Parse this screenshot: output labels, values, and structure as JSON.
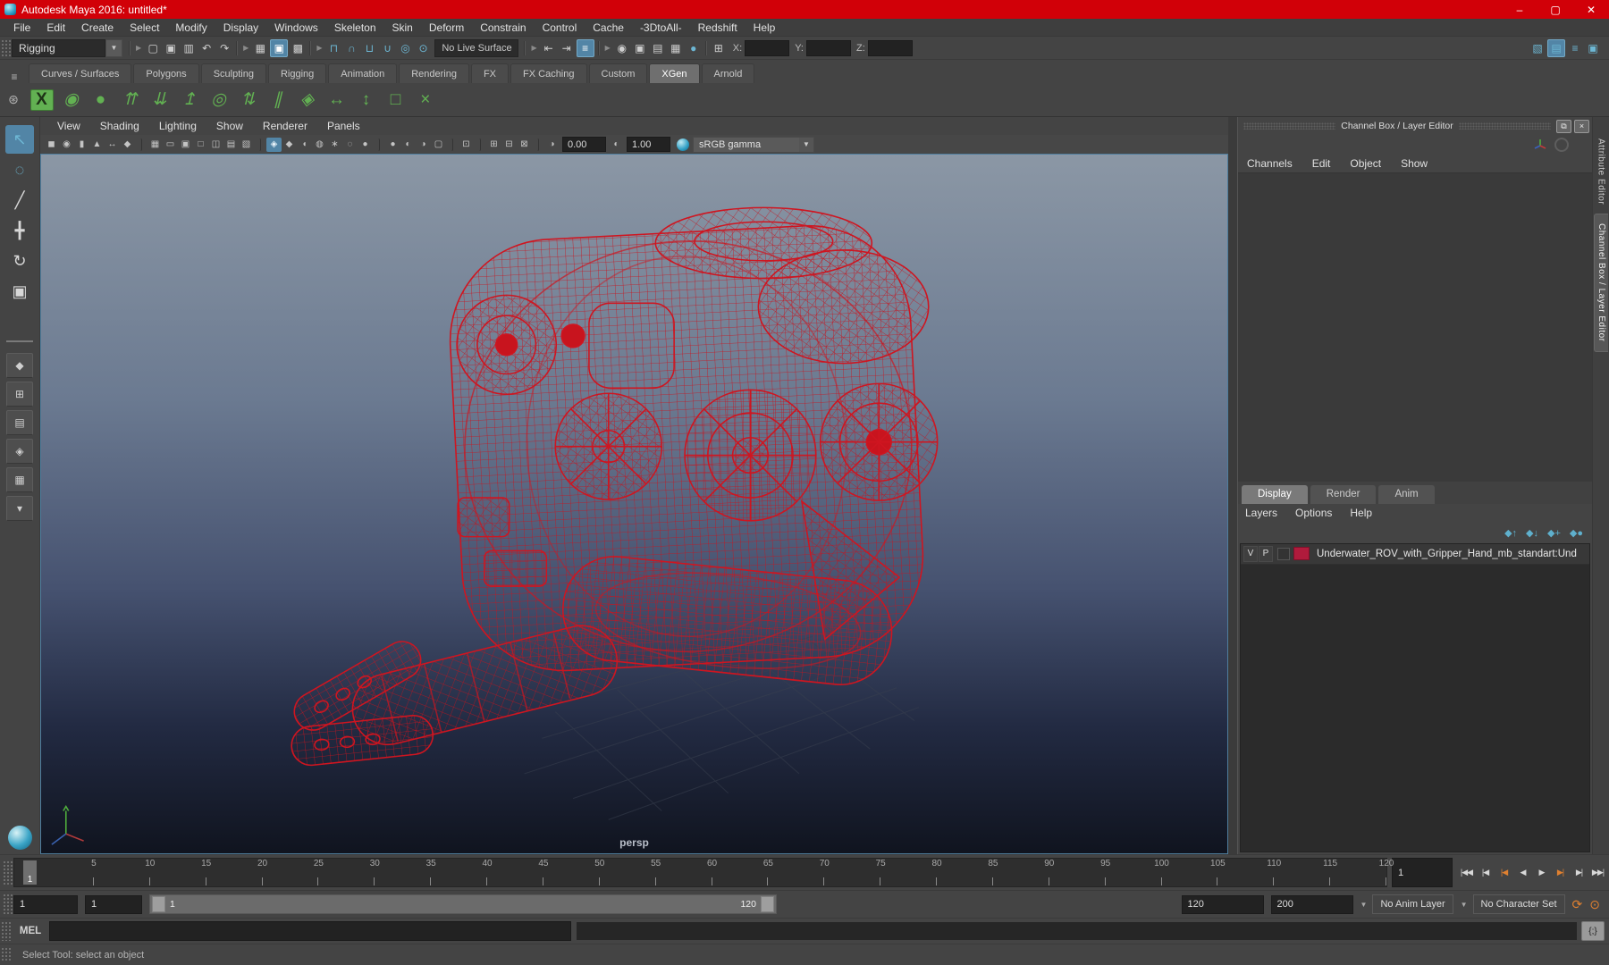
{
  "window": {
    "title": "Autodesk Maya 2016: untitled*",
    "controls": [
      {
        "name": "minimize-button",
        "g": "–"
      },
      {
        "name": "maximize-button",
        "g": "▢"
      },
      {
        "name": "close-button",
        "g": "✕"
      }
    ]
  },
  "menubar": {
    "items": [
      "File",
      "Edit",
      "Create",
      "Select",
      "Modify",
      "Display",
      "Windows",
      "Skeleton",
      "Skin",
      "Deform",
      "Constrain",
      "Control",
      "Cache",
      "-3DtoAll-",
      "Redshift",
      "Help"
    ]
  },
  "statusline": {
    "menuset": "Rigging",
    "file_icons": [
      {
        "g": "▢"
      },
      {
        "g": "▣"
      },
      {
        "g": "▥"
      },
      {
        "g": "↶"
      },
      {
        "g": "↷"
      }
    ],
    "selection_icons": [
      {
        "g": "▦"
      },
      {
        "g": "▣",
        "cls": "on"
      },
      {
        "g": "▩"
      }
    ],
    "snap_icons": [
      {
        "g": "⊓"
      },
      {
        "g": "∩"
      },
      {
        "g": "⊔"
      },
      {
        "g": "∪"
      },
      {
        "g": "◎"
      },
      {
        "g": "⊙"
      }
    ],
    "live_surface": "No Live Surface",
    "history_icons": [
      {
        "g": "⇤"
      },
      {
        "g": "⇥"
      },
      {
        "g": "≡",
        "cls": "on"
      }
    ],
    "render_icons": [
      {
        "g": "◉"
      },
      {
        "g": "▣"
      },
      {
        "g": "▤"
      },
      {
        "g": "▦"
      },
      {
        "g": "●",
        "cls": "teal"
      }
    ],
    "symmetry_icon": "⊞",
    "coords": [
      {
        "label": "X:"
      },
      {
        "label": "Y:"
      },
      {
        "label": "Z:"
      }
    ],
    "sidebar_toggles": [
      {
        "g": "▧"
      },
      {
        "g": "▤",
        "cls": "on"
      },
      {
        "g": "≡"
      },
      {
        "g": "▣",
        "cls": "teal"
      }
    ]
  },
  "shelf": {
    "menu_icon": "≡",
    "gear_icon": "⊛",
    "tabs": [
      {
        "label": "Curves / Surfaces"
      },
      {
        "label": "Polygons"
      },
      {
        "label": "Sculpting"
      },
      {
        "label": "Rigging"
      },
      {
        "label": "Animation"
      },
      {
        "label": "Rendering"
      },
      {
        "label": "FX"
      },
      {
        "label": "FX Caching"
      },
      {
        "label": "Custom"
      },
      {
        "label": "XGen",
        "cls": "active"
      },
      {
        "label": "Arnold"
      }
    ],
    "icons": [
      {
        "g": "X",
        "cls": "boxed"
      },
      {
        "g": "◉"
      },
      {
        "g": "●"
      },
      {
        "g": "⇈"
      },
      {
        "g": "⇊"
      },
      {
        "g": "↥"
      },
      {
        "g": "◎"
      },
      {
        "g": "⇅"
      },
      {
        "g": "∥"
      },
      {
        "g": "◈"
      },
      {
        "g": "↔"
      },
      {
        "g": "↕"
      },
      {
        "g": "□"
      },
      {
        "g": "×"
      }
    ]
  },
  "toolbox": {
    "tools": [
      {
        "g": "↖",
        "cls": "active"
      },
      {
        "g": "◌"
      },
      {
        "g": "╱"
      },
      {
        "g": "╋"
      },
      {
        "g": "↻"
      },
      {
        "g": "▣"
      }
    ],
    "layouts": [
      {
        "g": "◆"
      },
      {
        "g": "⊞"
      },
      {
        "g": "▤"
      },
      {
        "g": "◈"
      },
      {
        "g": "▦"
      },
      {
        "g": "▾"
      }
    ]
  },
  "viewport": {
    "menus": [
      "View",
      "Shading",
      "Lighting",
      "Show",
      "Renderer",
      "Panels"
    ],
    "toolbar_icons": [
      {
        "g": "◼"
      },
      {
        "g": "◉"
      },
      {
        "g": "▮"
      },
      {
        "g": "▲"
      },
      {
        "g": "↔"
      },
      {
        "g": "◆"
      },
      {
        "g": "",
        "cls": "sep"
      },
      {
        "g": "▦"
      },
      {
        "g": "▭"
      },
      {
        "g": "▣"
      },
      {
        "g": "□"
      },
      {
        "g": "◫"
      },
      {
        "g": "▤"
      },
      {
        "g": "▧"
      },
      {
        "g": "",
        "cls": "sep"
      },
      {
        "g": "◈",
        "cls": "on"
      },
      {
        "g": "◆"
      },
      {
        "g": "◖"
      },
      {
        "g": "◍"
      },
      {
        "g": "∗"
      },
      {
        "g": "◌"
      },
      {
        "g": "●"
      },
      {
        "g": "",
        "cls": "sep"
      },
      {
        "g": "●"
      },
      {
        "g": "◐"
      },
      {
        "g": "◑"
      },
      {
        "g": "▢"
      },
      {
        "g": "",
        "cls": "sep"
      },
      {
        "g": "⊡"
      },
      {
        "g": "",
        "cls": "sep"
      },
      {
        "g": "⊞"
      },
      {
        "g": "⊟"
      },
      {
        "g": "⊠"
      },
      {
        "g": "",
        "cls": "sep"
      }
    ],
    "exposure": "0.00",
    "gamma": "1.00",
    "color_mode": "sRGB gamma",
    "camera_label": "persp"
  },
  "channelbox": {
    "title": "Channel Box / Layer Editor",
    "popout_icon": "⧉",
    "close_icon": "×",
    "menus": [
      "Channels",
      "Edit",
      "Object",
      "Show"
    ]
  },
  "layer_editor": {
    "tabs": [
      {
        "label": "Display",
        "cls": "active"
      },
      {
        "label": "Render"
      },
      {
        "label": "Anim"
      }
    ],
    "menus": [
      "Layers",
      "Options",
      "Help"
    ],
    "tools": [
      {
        "g": "◆↑"
      },
      {
        "g": "◆↓"
      },
      {
        "g": "◆+"
      },
      {
        "g": "◆●"
      }
    ],
    "layers": [
      {
        "visibility": "V",
        "playback": "P",
        "name": "Underwater_ROV_with_Gripper_Hand_mb_standart:Und"
      }
    ]
  },
  "sidebar_tabs": [
    {
      "label": "Attribute Editor"
    },
    {
      "label": "Channel Box / Layer Editor",
      "cls": "active"
    }
  ],
  "timeline": {
    "current_frame": "1",
    "ticks": [
      {
        "label": "5"
      },
      {
        "label": "10"
      },
      {
        "label": "15"
      },
      {
        "label": "20"
      },
      {
        "label": "25"
      },
      {
        "label": "30"
      },
      {
        "label": "35"
      },
      {
        "label": "40"
      },
      {
        "label": "45"
      },
      {
        "label": "50"
      },
      {
        "label": "55"
      },
      {
        "label": "60"
      },
      {
        "label": "65"
      },
      {
        "label": "70"
      },
      {
        "label": "75"
      },
      {
        "label": "80"
      },
      {
        "label": "85"
      },
      {
        "label": "90"
      },
      {
        "label": "95"
      },
      {
        "label": "100"
      },
      {
        "label": "105"
      },
      {
        "label": "110"
      },
      {
        "label": "115"
      },
      {
        "label": "120"
      }
    ],
    "frame_field": "1",
    "playback": [
      {
        "g": "|◀◀"
      },
      {
        "g": "|◀"
      },
      {
        "g": "|◀",
        "cls": "accent"
      },
      {
        "g": "◀"
      },
      {
        "g": "▶"
      },
      {
        "g": "▶|",
        "cls": "accent"
      },
      {
        "g": "▶|"
      },
      {
        "g": "▶▶|"
      }
    ]
  },
  "range_slider": {
    "anim_start": "1",
    "play_start": "1",
    "bar_start": "1",
    "bar_end": "120",
    "play_end": "120",
    "anim_end": "200",
    "anim_layer": "No Anim Layer",
    "character_set": "No Character Set",
    "autokey_icon": "⟳",
    "charkey_icon": "⊙"
  },
  "command_line": {
    "label": "MEL",
    "script_editor_icon": "{;}"
  },
  "help_line": {
    "text": "Select Tool: select an object"
  },
  "colors": {
    "titlebar_red": "#d10008",
    "selection_blue": "#5285a6",
    "accent_teal": "#5fb0cd",
    "shelf_green": "#62b152",
    "wireframe_red": "#c8141e",
    "layer_swatch": "#b01b3c",
    "viewport_top": "#8b97a5",
    "viewport_bottom": "#10141f"
  }
}
